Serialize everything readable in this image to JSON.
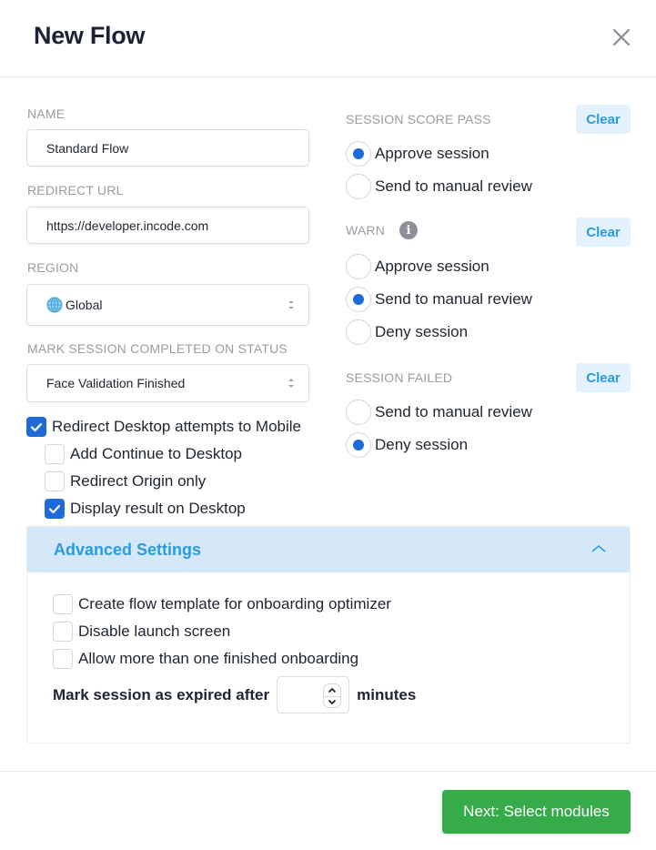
{
  "header": {
    "title": "New Flow",
    "close_icon": "close-icon"
  },
  "form": {
    "name": {
      "label": "NAME",
      "value": "Standard Flow"
    },
    "redirect_url": {
      "label": "REDIRECT URL",
      "value": "https://developer.incode.com"
    },
    "region": {
      "label": "REGION",
      "value": "Global",
      "icon": "globe-icon"
    },
    "mark_completed": {
      "label": "MARK SESSION COMPLETED ON STATUS",
      "value": "Face Validation Finished"
    },
    "checkboxes": [
      {
        "label": "Redirect Desktop attempts to Mobile",
        "checked": true
      },
      {
        "label": "Add Continue to Desktop",
        "checked": false
      },
      {
        "label": "Redirect Origin only",
        "checked": false
      },
      {
        "label": "Display result on Desktop",
        "checked": true
      }
    ]
  },
  "outcomes": {
    "clear_label": "Clear",
    "session_score_pass": {
      "label": "SESSION SCORE PASS",
      "options": [
        {
          "label": "Approve session",
          "checked": true
        },
        {
          "label": "Send to manual review",
          "checked": false
        }
      ]
    },
    "warn": {
      "label": "WARN",
      "info_glyph": "i",
      "options": [
        {
          "label": "Approve session",
          "checked": false
        },
        {
          "label": "Send to manual review",
          "checked": true
        },
        {
          "label": "Deny session",
          "checked": false
        }
      ]
    },
    "session_failed": {
      "label": "SESSION FAILED",
      "options": [
        {
          "label": "Send to manual review",
          "checked": false
        },
        {
          "label": "Deny session",
          "checked": true
        }
      ]
    }
  },
  "advanced": {
    "title": "Advanced Settings",
    "expanded": true,
    "checkboxes": [
      {
        "label": "Create flow template for onboarding optimizer",
        "checked": false
      },
      {
        "label": "Disable launch screen",
        "checked": false
      },
      {
        "label": "Allow more than one finished onboarding",
        "checked": false
      }
    ],
    "expire": {
      "prefix": "Mark session as expired after",
      "value": "",
      "suffix": "minutes"
    }
  },
  "footer": {
    "next_label": "Next: Select modules"
  },
  "colors": {
    "accent": "#1e6ad9",
    "link": "#2a9be0",
    "primary_button": "#36ab4a",
    "advanced_header_bg": "#d4e8f8"
  }
}
